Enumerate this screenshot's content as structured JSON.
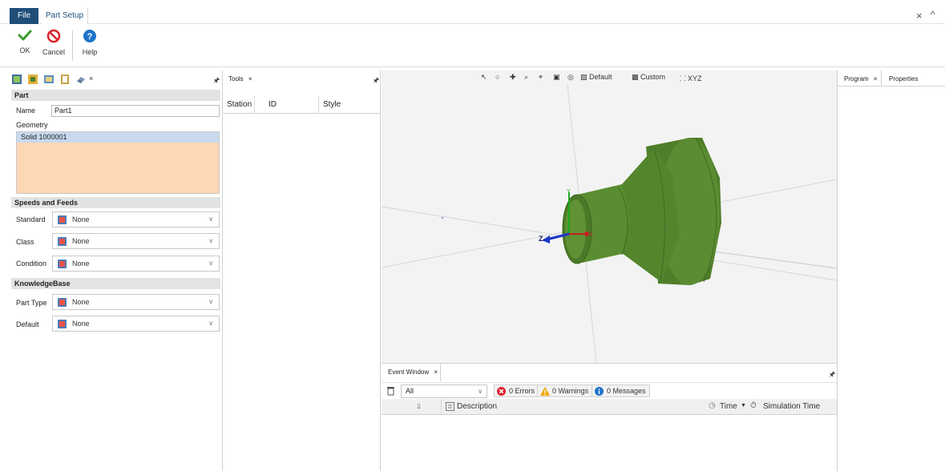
{
  "top": {
    "file_tab": "File",
    "setup_tab": "Part Setup",
    "close_glyph": "×",
    "collapse_glyph": "^"
  },
  "ribbon": {
    "ok_label": "OK",
    "cancel_label": "Cancel",
    "help_label": "Help"
  },
  "left_panel": {
    "close_glyph": "×",
    "part": {
      "header": "Part",
      "name_label": "Name",
      "name_value": "Part1",
      "geometry_label": "Geometry",
      "geometry_items": [
        "Solid 1000001"
      ]
    },
    "speeds_feeds": {
      "header": "Speeds and Feeds",
      "rows": [
        {
          "label": "Standard",
          "value": "None"
        },
        {
          "label": "Class",
          "value": "None"
        },
        {
          "label": "Condition",
          "value": "None"
        }
      ]
    },
    "knowledge_base": {
      "header": "KnowledgeBase",
      "rows": [
        {
          "label": "Part Type",
          "value": "None"
        },
        {
          "label": "Default",
          "value": "None"
        }
      ]
    }
  },
  "tools_panel": {
    "tab_label": "Tools",
    "close_glyph": "×",
    "columns": [
      "Station",
      "ID",
      "Style"
    ]
  },
  "viewport": {
    "toolbar": {
      "default_label": "Default",
      "custom_label": "Custom",
      "xyz_label": "XYZ"
    },
    "axes": {
      "z_label": "Z",
      "x_label": "X",
      "y_label": "Y"
    },
    "part_color": "#4f7f2b"
  },
  "event_window": {
    "tab_label": "Event Window",
    "close_glyph": "×",
    "filter_value": "All",
    "errors": "0 Errors",
    "warnings": "0 Warnings",
    "messages": "0 Messages",
    "columns": {
      "description": "Description",
      "time": "Time",
      "simulation_time": "Simulation Time"
    }
  },
  "right_panel": {
    "program_tab": "Program",
    "close_glyph": "×",
    "properties_tab": "Properties"
  },
  "colors": {
    "file_tab_bg": "#1f4e79",
    "geometry_bg": "#fed7b5",
    "selection_bg": "#c8d9ef",
    "ok_green": "#3a9d2c",
    "cancel_red": "#d9232e",
    "help_blue": "#1e73c9"
  }
}
